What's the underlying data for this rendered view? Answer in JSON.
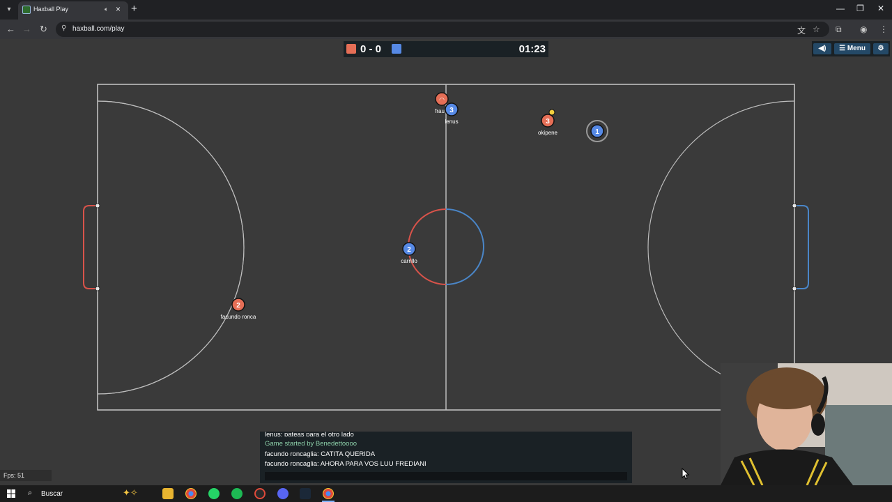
{
  "browser": {
    "tab_title": "Haxball Play",
    "url": "haxball.com/play",
    "window_controls": [
      "minimize-icon",
      "restore-icon",
      "close-icon"
    ]
  },
  "scoreboard": {
    "red_score": "0",
    "separator": "-",
    "blue_score": "0",
    "score_text": "0 - 0",
    "timer": "01:23",
    "colors": {
      "red": "#e56e56",
      "blue": "#5689e5"
    }
  },
  "top_buttons": {
    "sound_icon": "speaker-icon",
    "menu_label": "Menu",
    "settings_icon": "gear-icon"
  },
  "players": [
    {
      "team": "red",
      "number": "",
      "name": "frau"
    },
    {
      "team": "blue",
      "number": "3",
      "name": "lenus"
    },
    {
      "team": "red",
      "number": "3",
      "name": "okipene"
    },
    {
      "team": "blue",
      "number": "1",
      "name": ""
    },
    {
      "team": "blue",
      "number": "2",
      "name": "carrillo"
    },
    {
      "team": "red",
      "number": "2",
      "name": "facundo ronca"
    }
  ],
  "fps": "Fps: 51",
  "chat": {
    "lines": [
      {
        "text": "lenus: pateas para el otro lado",
        "color": "#ffffff"
      },
      {
        "text": "Game started by Benedettoooo",
        "color": "#8ed2ab"
      },
      {
        "text": "facundo roncaglia: CATITA QUERIDA",
        "color": "#ffffff"
      },
      {
        "text": "facundo roncaglia: AHORA PARA VOS LUU FREDIANI",
        "color": "#ffffff"
      }
    ],
    "input_value": ""
  },
  "taskbar": {
    "search_label": "Buscar",
    "apps": [
      "file-explorer-icon",
      "chrome-icon",
      "whatsapp-icon",
      "spotify-icon",
      "app-icon",
      "discord-icon",
      "steam-icon",
      "chrome-active-icon"
    ]
  }
}
